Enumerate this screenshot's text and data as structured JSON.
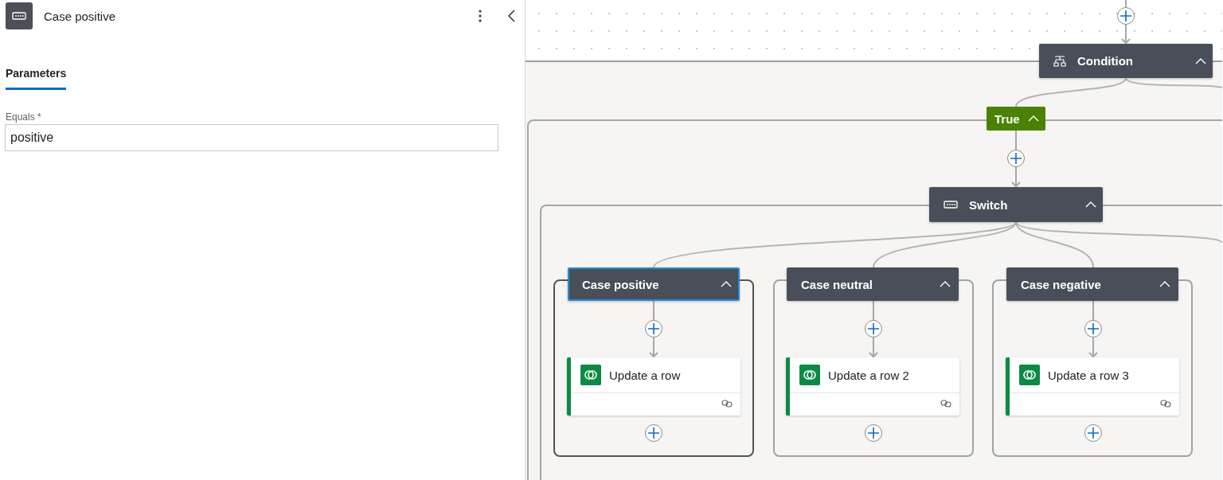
{
  "panel": {
    "title": "Case positive",
    "tabs": [
      {
        "label": "Parameters",
        "selected": true
      }
    ],
    "field": {
      "label": "Equals *",
      "value": "positive"
    }
  },
  "canvas": {
    "condition": {
      "title": "Condition"
    },
    "branch": {
      "label": "True"
    },
    "switch": {
      "title": "Switch"
    },
    "cases": [
      {
        "title": "Case positive",
        "selected": true,
        "action": {
          "title": "Update a row"
        }
      },
      {
        "title": "Case neutral",
        "selected": false,
        "action": {
          "title": "Update a row 2"
        }
      },
      {
        "title": "Case negative",
        "selected": false,
        "action": {
          "title": "Update a row 3"
        }
      }
    ]
  }
}
